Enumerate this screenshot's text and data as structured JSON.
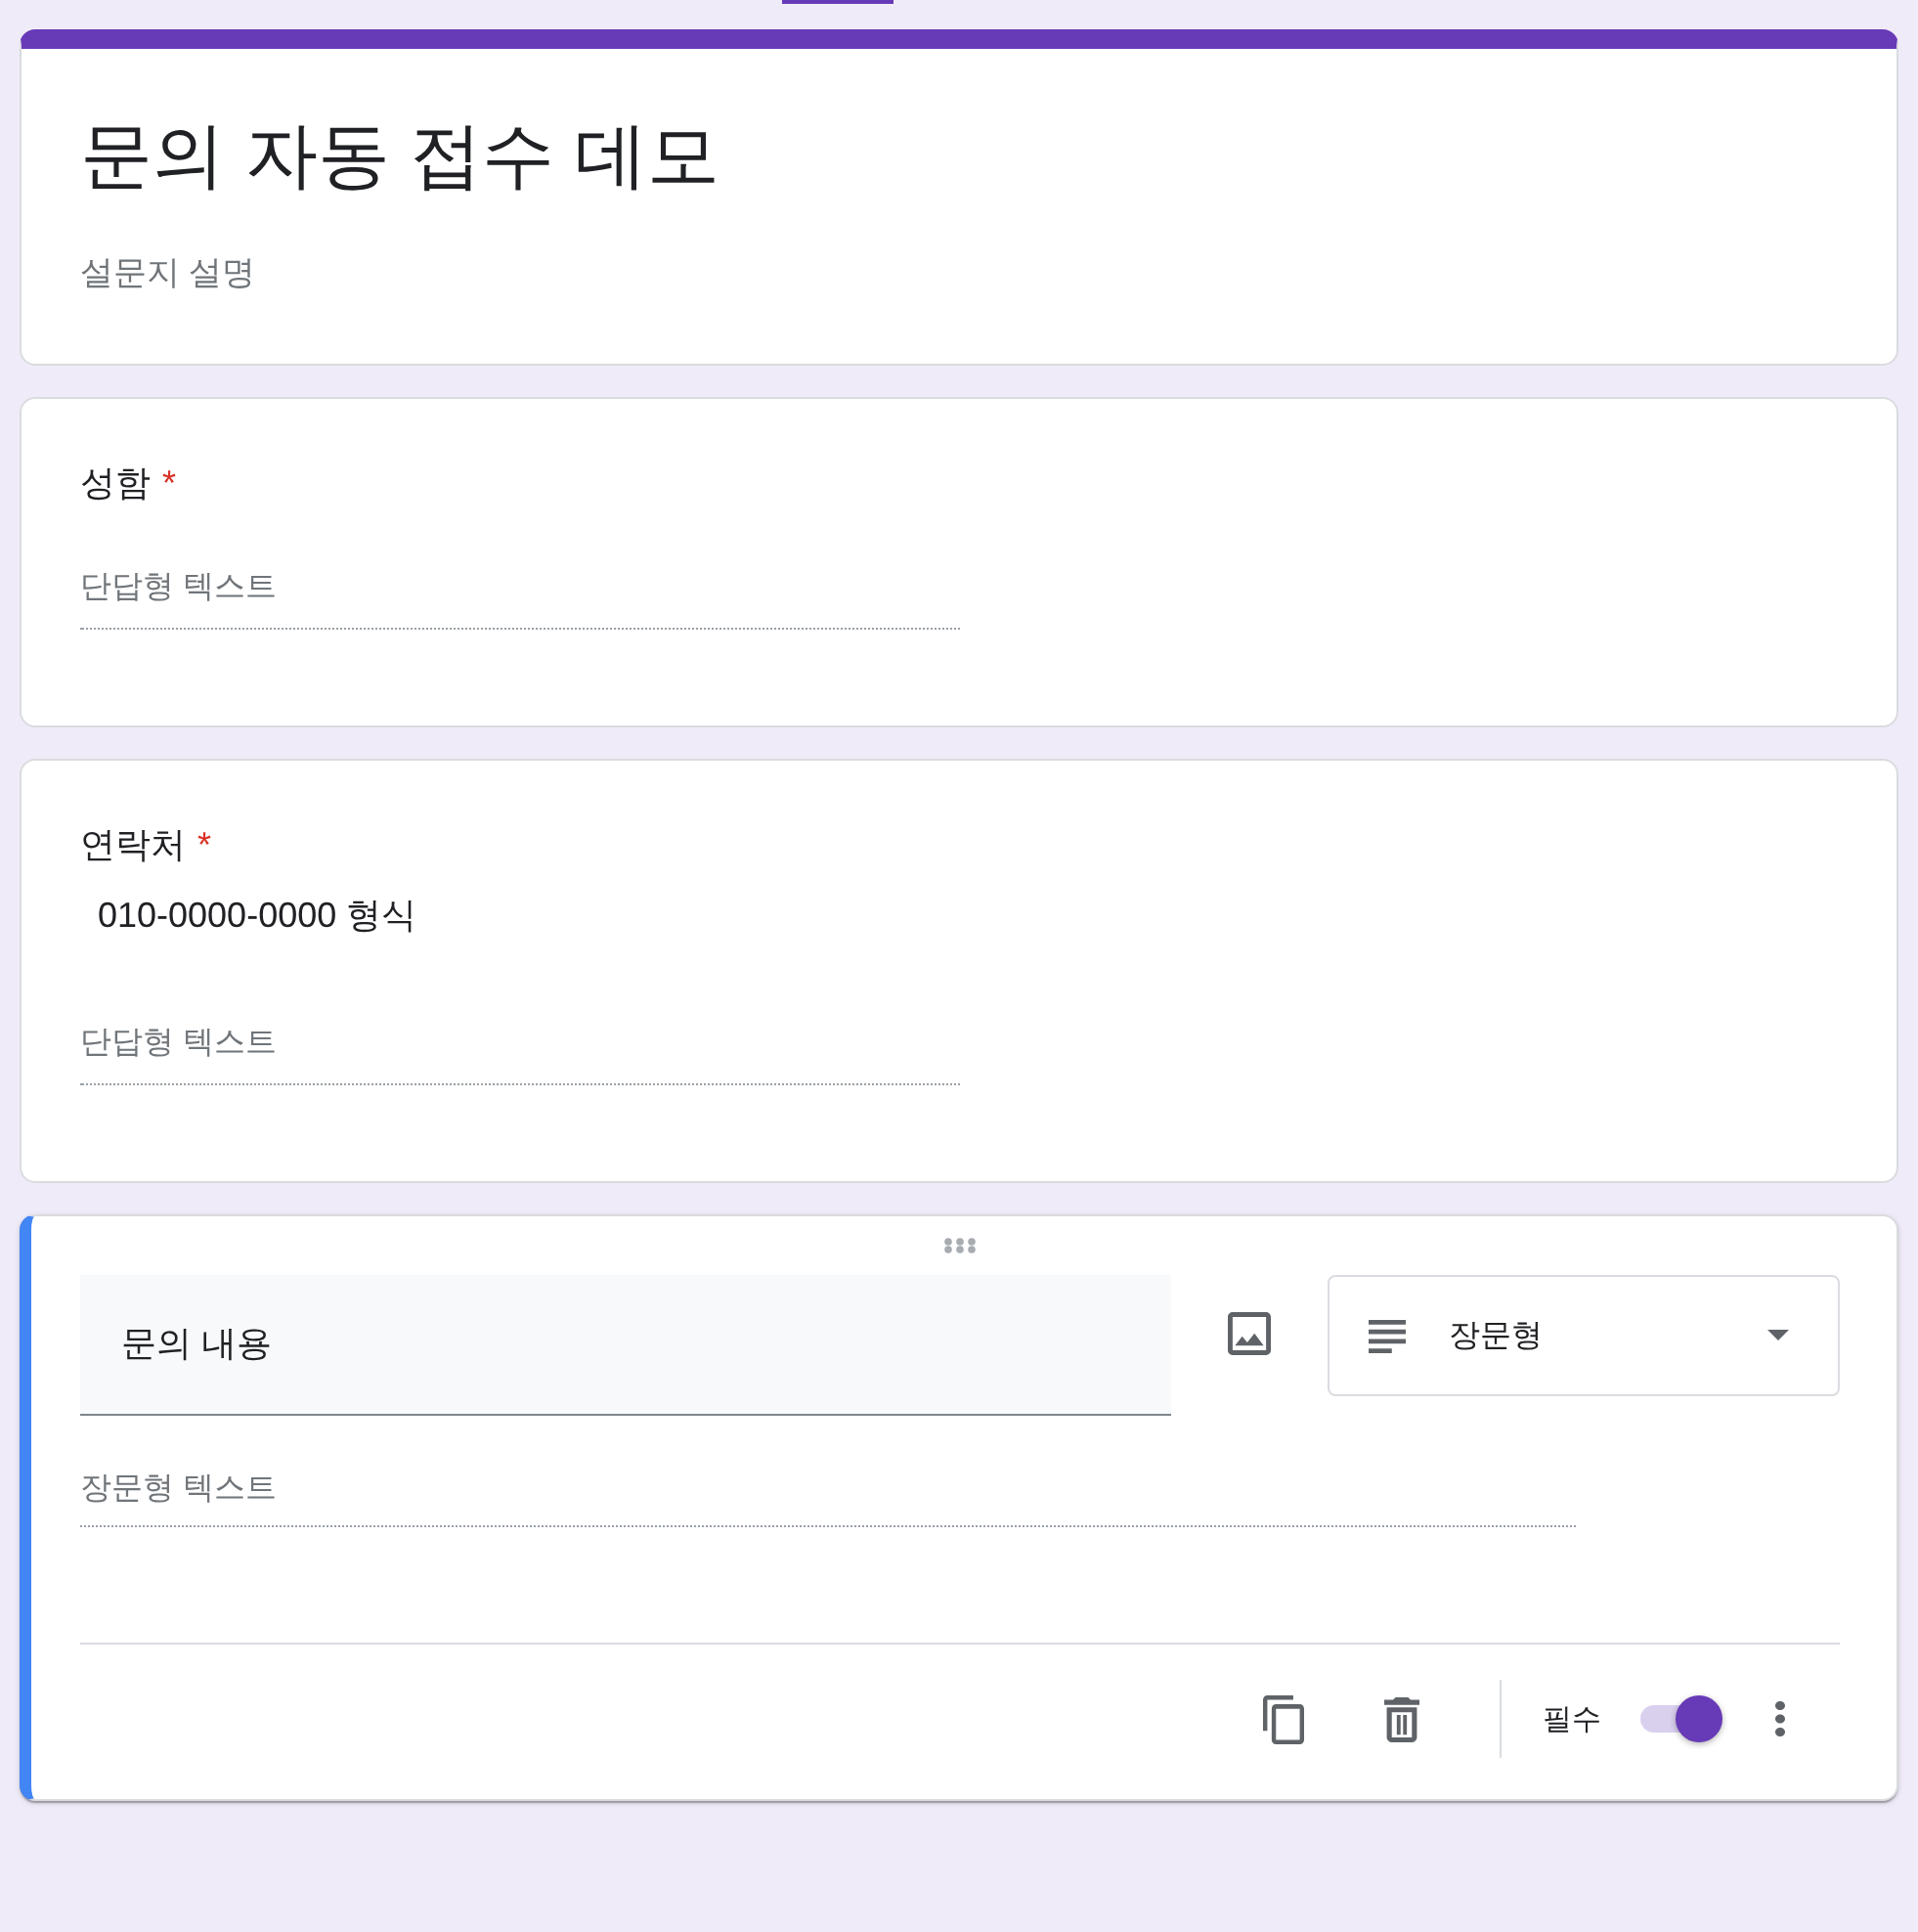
{
  "form_header": {
    "title": "문의 자동 접수 데모",
    "description": "설문지 설명"
  },
  "questions": [
    {
      "kind": "short",
      "selected": false,
      "title": "성함",
      "required": true,
      "required_mark": "*",
      "placeholder": "단답형 텍스트"
    },
    {
      "kind": "short",
      "selected": false,
      "title": "연락처",
      "required": true,
      "required_mark": "*",
      "description": "010-0000-0000 형식",
      "placeholder": "단답형 텍스트"
    },
    {
      "kind": "paragraph",
      "selected": true,
      "title": "문의 내용",
      "type_label": "장문형",
      "placeholder": "장문형 텍스트",
      "required_label": "필수",
      "required": true
    }
  ]
}
